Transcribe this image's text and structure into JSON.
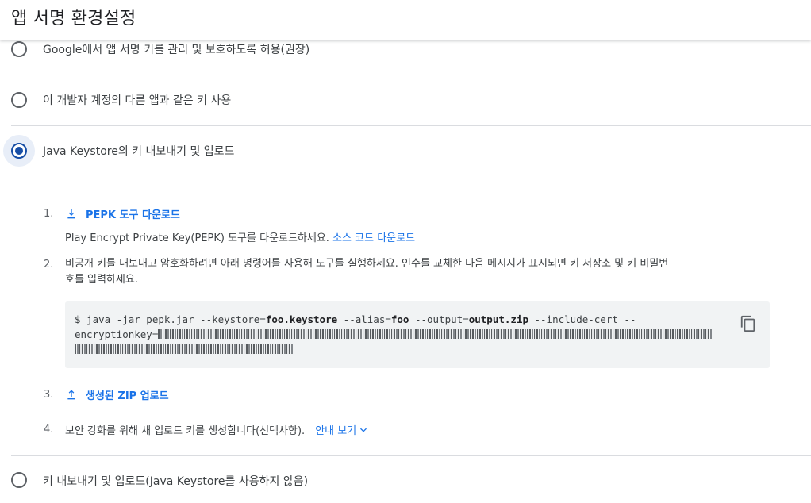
{
  "header": {
    "title": "앱 서명 환경설정"
  },
  "options": [
    {
      "label": "Google에서 앱 서명 키를 관리 및 보호하도록 허용(권장)",
      "checked": false
    },
    {
      "label": "이 개발자 계정의 다른 앱과 같은 키 사용",
      "checked": false
    },
    {
      "label": "Java Keystore의 키 내보내기 및 업로드",
      "checked": true
    },
    {
      "label": "키 내보내기 및 업로드(Java Keystore를 사용하지 않음)",
      "checked": false
    }
  ],
  "steps": {
    "s1": {
      "num": "1.",
      "link": "PEPK 도구 다운로드",
      "desc": "Play Encrypt Private Key(PEPK) 도구를 다운로드하세요.",
      "desc_link": "소스 코드 다운로드"
    },
    "s2": {
      "num": "2.",
      "text_line1": "비공개 키를 내보내고 암호화하려면 아래 명령어를 사용해 도구를 실행하세요. 인수를 교체한 다음 메시지가 표시되면 키 저장소 및 키 비밀번",
      "text_line2": "호를 입력하세요."
    },
    "code": {
      "p1": "$ java -jar pepk.jar --keystore=",
      "b1": "foo.keystore",
      "p2": " --alias=",
      "b2": "foo",
      "p3": " --output=",
      "b3": "output.zip",
      "p4": " --include-cert --",
      "p5": "encryptionkey="
    },
    "s3": {
      "num": "3.",
      "link": "생성된 ZIP 업로드"
    },
    "s4": {
      "num": "4.",
      "text": "보안 강화를 위해 새 업로드 키를 생성합니다(선택사항).",
      "link": "안내 보기"
    }
  },
  "icons": {
    "download": "download-icon",
    "upload": "upload-icon",
    "copy": "copy-icon",
    "chevron": "chevron-down-icon"
  },
  "colors": {
    "accent": "#1a73e8",
    "radio_checked": "#174ea6",
    "code_bg": "#f1f3f4",
    "divider": "#dadce0"
  }
}
